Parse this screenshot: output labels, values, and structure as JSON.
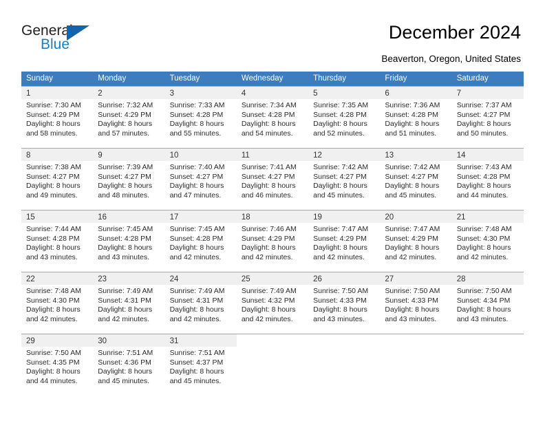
{
  "brand": {
    "name_part1": "General",
    "name_part2": "Blue",
    "triangle_color": "#1464ad",
    "blue_color": "#1c7cc4"
  },
  "header": {
    "title": "December 2024",
    "location": "Beaverton, Oregon, United States"
  },
  "calendar": {
    "header_color": "#3c7cbf",
    "weekdays": [
      "Sunday",
      "Monday",
      "Tuesday",
      "Wednesday",
      "Thursday",
      "Friday",
      "Saturday"
    ],
    "weeks": [
      [
        {
          "day": "1",
          "sunrise": "Sunrise: 7:30 AM",
          "sunset": "Sunset: 4:29 PM",
          "daylight1": "Daylight: 8 hours",
          "daylight2": "and 58 minutes."
        },
        {
          "day": "2",
          "sunrise": "Sunrise: 7:32 AM",
          "sunset": "Sunset: 4:29 PM",
          "daylight1": "Daylight: 8 hours",
          "daylight2": "and 57 minutes."
        },
        {
          "day": "3",
          "sunrise": "Sunrise: 7:33 AM",
          "sunset": "Sunset: 4:28 PM",
          "daylight1": "Daylight: 8 hours",
          "daylight2": "and 55 minutes."
        },
        {
          "day": "4",
          "sunrise": "Sunrise: 7:34 AM",
          "sunset": "Sunset: 4:28 PM",
          "daylight1": "Daylight: 8 hours",
          "daylight2": "and 54 minutes."
        },
        {
          "day": "5",
          "sunrise": "Sunrise: 7:35 AM",
          "sunset": "Sunset: 4:28 PM",
          "daylight1": "Daylight: 8 hours",
          "daylight2": "and 52 minutes."
        },
        {
          "day": "6",
          "sunrise": "Sunrise: 7:36 AM",
          "sunset": "Sunset: 4:28 PM",
          "daylight1": "Daylight: 8 hours",
          "daylight2": "and 51 minutes."
        },
        {
          "day": "7",
          "sunrise": "Sunrise: 7:37 AM",
          "sunset": "Sunset: 4:27 PM",
          "daylight1": "Daylight: 8 hours",
          "daylight2": "and 50 minutes."
        }
      ],
      [
        {
          "day": "8",
          "sunrise": "Sunrise: 7:38 AM",
          "sunset": "Sunset: 4:27 PM",
          "daylight1": "Daylight: 8 hours",
          "daylight2": "and 49 minutes."
        },
        {
          "day": "9",
          "sunrise": "Sunrise: 7:39 AM",
          "sunset": "Sunset: 4:27 PM",
          "daylight1": "Daylight: 8 hours",
          "daylight2": "and 48 minutes."
        },
        {
          "day": "10",
          "sunrise": "Sunrise: 7:40 AM",
          "sunset": "Sunset: 4:27 PM",
          "daylight1": "Daylight: 8 hours",
          "daylight2": "and 47 minutes."
        },
        {
          "day": "11",
          "sunrise": "Sunrise: 7:41 AM",
          "sunset": "Sunset: 4:27 PM",
          "daylight1": "Daylight: 8 hours",
          "daylight2": "and 46 minutes."
        },
        {
          "day": "12",
          "sunrise": "Sunrise: 7:42 AM",
          "sunset": "Sunset: 4:27 PM",
          "daylight1": "Daylight: 8 hours",
          "daylight2": "and 45 minutes."
        },
        {
          "day": "13",
          "sunrise": "Sunrise: 7:42 AM",
          "sunset": "Sunset: 4:27 PM",
          "daylight1": "Daylight: 8 hours",
          "daylight2": "and 45 minutes."
        },
        {
          "day": "14",
          "sunrise": "Sunrise: 7:43 AM",
          "sunset": "Sunset: 4:28 PM",
          "daylight1": "Daylight: 8 hours",
          "daylight2": "and 44 minutes."
        }
      ],
      [
        {
          "day": "15",
          "sunrise": "Sunrise: 7:44 AM",
          "sunset": "Sunset: 4:28 PM",
          "daylight1": "Daylight: 8 hours",
          "daylight2": "and 43 minutes."
        },
        {
          "day": "16",
          "sunrise": "Sunrise: 7:45 AM",
          "sunset": "Sunset: 4:28 PM",
          "daylight1": "Daylight: 8 hours",
          "daylight2": "and 43 minutes."
        },
        {
          "day": "17",
          "sunrise": "Sunrise: 7:45 AM",
          "sunset": "Sunset: 4:28 PM",
          "daylight1": "Daylight: 8 hours",
          "daylight2": "and 42 minutes."
        },
        {
          "day": "18",
          "sunrise": "Sunrise: 7:46 AM",
          "sunset": "Sunset: 4:29 PM",
          "daylight1": "Daylight: 8 hours",
          "daylight2": "and 42 minutes."
        },
        {
          "day": "19",
          "sunrise": "Sunrise: 7:47 AM",
          "sunset": "Sunset: 4:29 PM",
          "daylight1": "Daylight: 8 hours",
          "daylight2": "and 42 minutes."
        },
        {
          "day": "20",
          "sunrise": "Sunrise: 7:47 AM",
          "sunset": "Sunset: 4:29 PM",
          "daylight1": "Daylight: 8 hours",
          "daylight2": "and 42 minutes."
        },
        {
          "day": "21",
          "sunrise": "Sunrise: 7:48 AM",
          "sunset": "Sunset: 4:30 PM",
          "daylight1": "Daylight: 8 hours",
          "daylight2": "and 42 minutes."
        }
      ],
      [
        {
          "day": "22",
          "sunrise": "Sunrise: 7:48 AM",
          "sunset": "Sunset: 4:30 PM",
          "daylight1": "Daylight: 8 hours",
          "daylight2": "and 42 minutes."
        },
        {
          "day": "23",
          "sunrise": "Sunrise: 7:49 AM",
          "sunset": "Sunset: 4:31 PM",
          "daylight1": "Daylight: 8 hours",
          "daylight2": "and 42 minutes."
        },
        {
          "day": "24",
          "sunrise": "Sunrise: 7:49 AM",
          "sunset": "Sunset: 4:31 PM",
          "daylight1": "Daylight: 8 hours",
          "daylight2": "and 42 minutes."
        },
        {
          "day": "25",
          "sunrise": "Sunrise: 7:49 AM",
          "sunset": "Sunset: 4:32 PM",
          "daylight1": "Daylight: 8 hours",
          "daylight2": "and 42 minutes."
        },
        {
          "day": "26",
          "sunrise": "Sunrise: 7:50 AM",
          "sunset": "Sunset: 4:33 PM",
          "daylight1": "Daylight: 8 hours",
          "daylight2": "and 43 minutes."
        },
        {
          "day": "27",
          "sunrise": "Sunrise: 7:50 AM",
          "sunset": "Sunset: 4:33 PM",
          "daylight1": "Daylight: 8 hours",
          "daylight2": "and 43 minutes."
        },
        {
          "day": "28",
          "sunrise": "Sunrise: 7:50 AM",
          "sunset": "Sunset: 4:34 PM",
          "daylight1": "Daylight: 8 hours",
          "daylight2": "and 43 minutes."
        }
      ],
      [
        {
          "day": "29",
          "sunrise": "Sunrise: 7:50 AM",
          "sunset": "Sunset: 4:35 PM",
          "daylight1": "Daylight: 8 hours",
          "daylight2": "and 44 minutes."
        },
        {
          "day": "30",
          "sunrise": "Sunrise: 7:51 AM",
          "sunset": "Sunset: 4:36 PM",
          "daylight1": "Daylight: 8 hours",
          "daylight2": "and 45 minutes."
        },
        {
          "day": "31",
          "sunrise": "Sunrise: 7:51 AM",
          "sunset": "Sunset: 4:37 PM",
          "daylight1": "Daylight: 8 hours",
          "daylight2": "and 45 minutes."
        },
        {
          "day": "",
          "sunrise": "",
          "sunset": "",
          "daylight1": "",
          "daylight2": ""
        },
        {
          "day": "",
          "sunrise": "",
          "sunset": "",
          "daylight1": "",
          "daylight2": ""
        },
        {
          "day": "",
          "sunrise": "",
          "sunset": "",
          "daylight1": "",
          "daylight2": ""
        },
        {
          "day": "",
          "sunrise": "",
          "sunset": "",
          "daylight1": "",
          "daylight2": ""
        }
      ]
    ]
  }
}
